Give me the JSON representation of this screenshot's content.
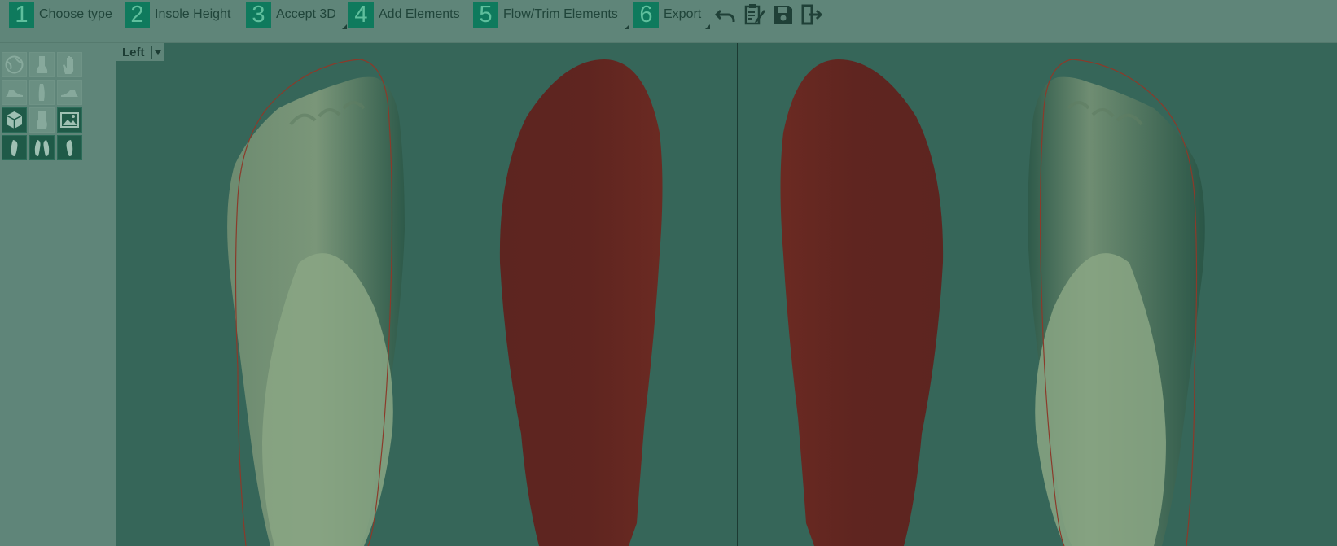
{
  "toolbar": {
    "steps": [
      {
        "num": "1",
        "label": "Choose type"
      },
      {
        "num": "2",
        "label": "Insole Height"
      },
      {
        "num": "3",
        "label": "Accept 3D"
      },
      {
        "num": "4",
        "label": "Add Elements"
      },
      {
        "num": "5",
        "label": "Flow/Trim Elements"
      },
      {
        "num": "6",
        "label": "Export"
      }
    ],
    "icons": [
      "undo-icon",
      "clipboard-edit-icon",
      "save-icon",
      "exit-icon"
    ]
  },
  "view_selector": {
    "value": "Left"
  },
  "left_panel": {
    "buttons": [
      "globe-view-icon",
      "foot-back-icon",
      "hand-icon",
      "foot-side-icon",
      "foot-front-icon",
      "foot-side-right-icon",
      "cube-icon",
      "foot-shape-icon",
      "image-icon",
      "left-foot-icon",
      "both-feet-icon",
      "right-foot-icon"
    ]
  },
  "colors": {
    "background": "#5f8579",
    "viewport": "#366659",
    "step_badge": "#0f7a5d",
    "insole": "#6a2620",
    "foot": "#7e9a7c"
  }
}
